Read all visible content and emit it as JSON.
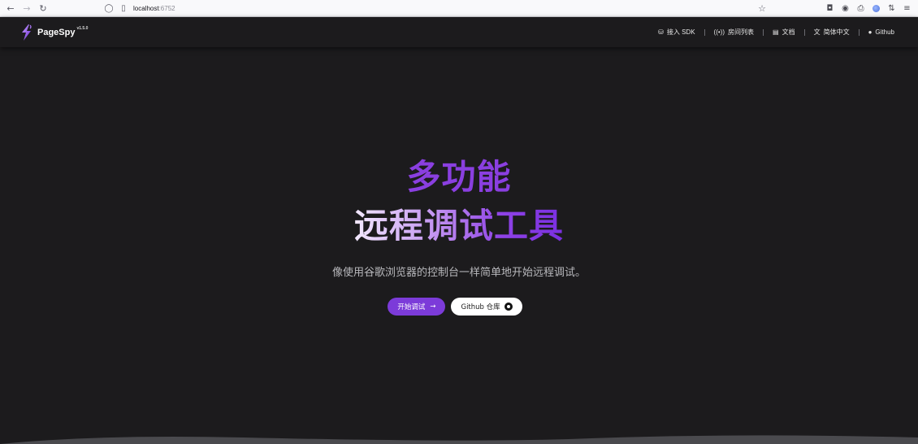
{
  "browser": {
    "url_host": "localhost",
    "url_port": ":6752"
  },
  "header": {
    "brand": "PageSpy",
    "version": "v1.5.0",
    "menu": [
      {
        "label": "接入 SDK",
        "icon": "sdk-icon"
      },
      {
        "label": "房间列表",
        "icon": "broadcast-icon"
      },
      {
        "label": "文档",
        "icon": "document-icon"
      },
      {
        "label": "简体中文",
        "icon": "translate-icon"
      },
      {
        "label": "Github",
        "icon": "github-icon"
      }
    ]
  },
  "hero": {
    "title_line1": "多功能",
    "title_line2": "远程调试工具",
    "subtitle": "像使用谷歌浏览器的控制台一样简单地开始远程调试。",
    "primary_button": "开始调试",
    "secondary_button": "Github 仓库"
  },
  "colors": {
    "background": "#1c1b1d",
    "accent": "#7c3bd9",
    "title_purple": "#8a3fe0"
  }
}
